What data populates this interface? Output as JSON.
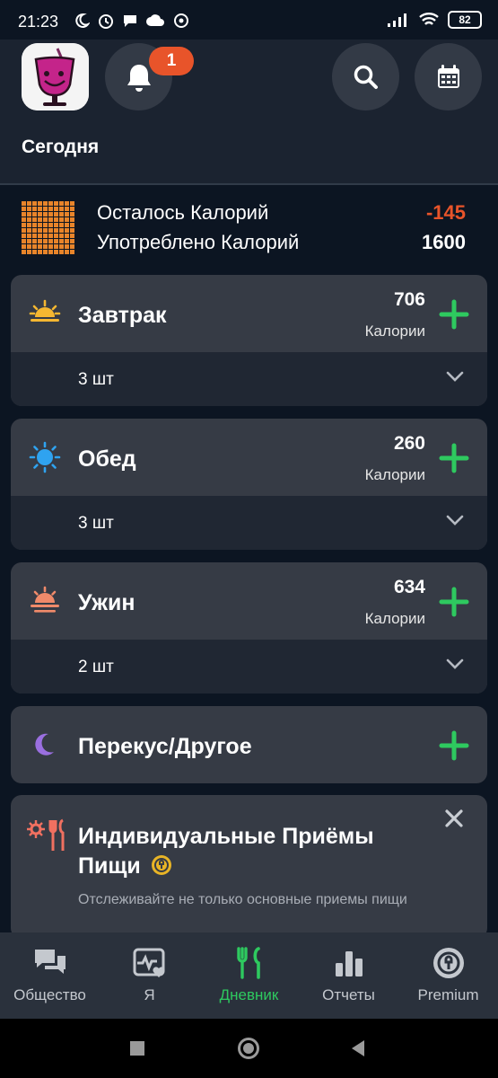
{
  "status_bar": {
    "time": "21:23",
    "battery": "82"
  },
  "header": {
    "notification_count": "1",
    "section_title": "Сегодня"
  },
  "summary": {
    "remaining_label": "Осталось Калорий",
    "remaining_value": "-145",
    "consumed_label": "Употреблено Калорий",
    "consumed_value": "1600"
  },
  "meals": [
    {
      "title": "Завтрак",
      "calories": "706",
      "unit": "Калории",
      "count": "3 шт",
      "icon": "sunrise-icon"
    },
    {
      "title": "Обед",
      "calories": "260",
      "unit": "Калории",
      "count": "3 шт",
      "icon": "sun-icon"
    },
    {
      "title": "Ужин",
      "calories": "634",
      "unit": "Калории",
      "count": "2 шт",
      "icon": "sunset-icon"
    },
    {
      "title": "Перекус/Другое",
      "icon": "moon-icon"
    }
  ],
  "promo": {
    "title": "Индивидуальные Приёмы Пищи",
    "subtitle": "Отслеживайте не только основные приемы пищи"
  },
  "nav": [
    {
      "label": "Общество",
      "icon": "community-icon"
    },
    {
      "label": "Я",
      "icon": "me-icon"
    },
    {
      "label": "Дневник",
      "icon": "diary-icon"
    },
    {
      "label": "Отчеты",
      "icon": "reports-icon"
    },
    {
      "label": "Premium",
      "icon": "premium-icon"
    }
  ],
  "colors": {
    "accent_green": "#2ec95f",
    "negative_orange": "#e8542a",
    "background": "#0c1522",
    "card": "#363b45"
  }
}
